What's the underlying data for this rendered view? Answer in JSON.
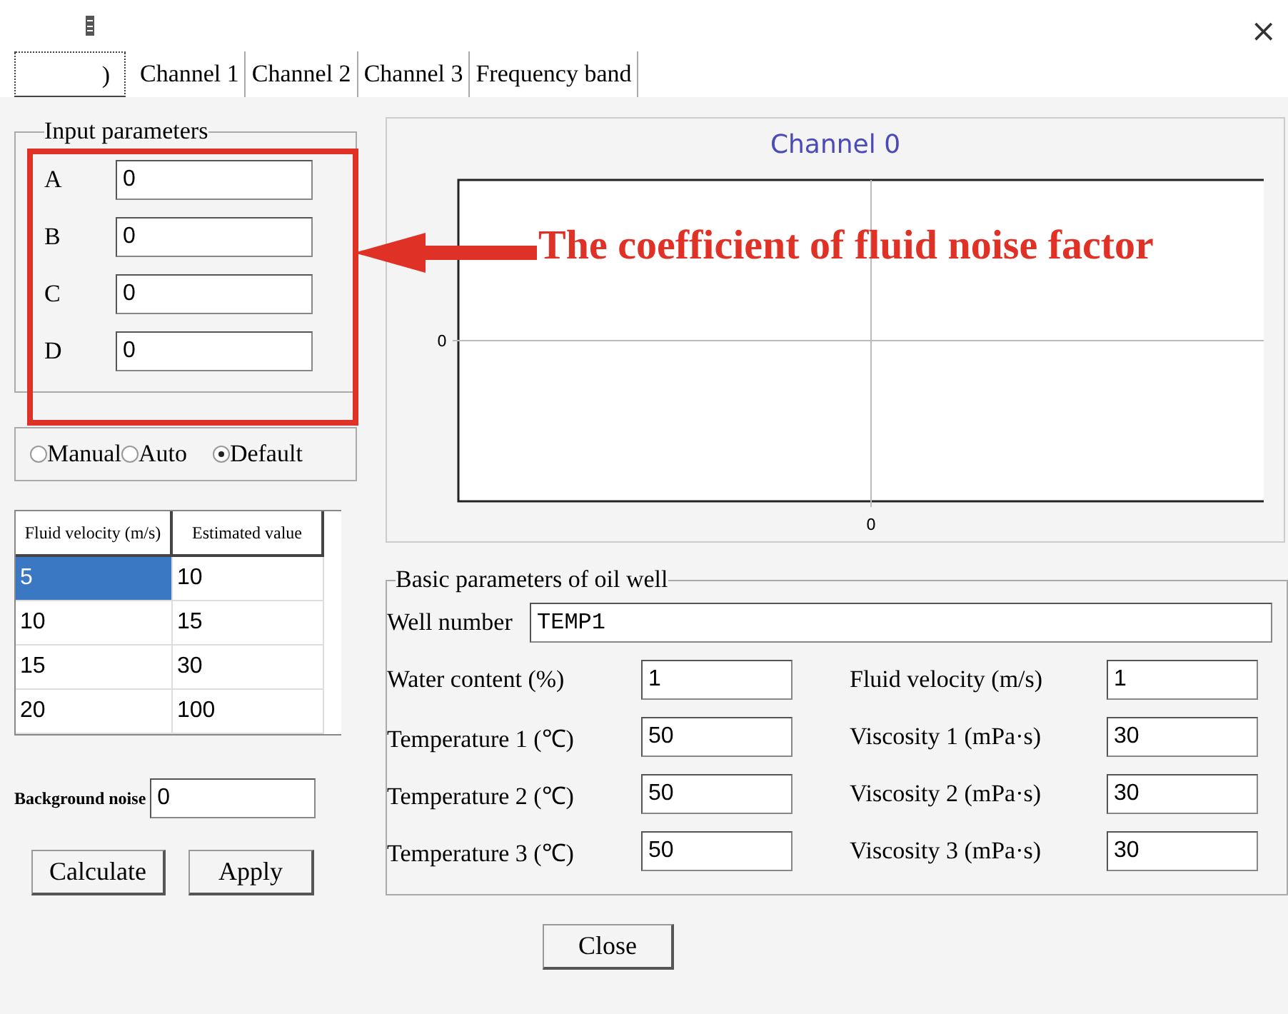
{
  "window": {
    "close": "×"
  },
  "tabs": [
    {
      "label": ")",
      "selected": true
    },
    {
      "label": "Channel 1",
      "selected": false
    },
    {
      "label": "Channel 2",
      "selected": false
    },
    {
      "label": "Channel 3",
      "selected": false
    },
    {
      "label": "Frequency band",
      "selected": false
    }
  ],
  "input_parameters": {
    "title": "Input parameters",
    "fields": [
      {
        "label": "A",
        "value": "0"
      },
      {
        "label": "B",
        "value": "0"
      },
      {
        "label": "C",
        "value": "0"
      },
      {
        "label": "D",
        "value": "0"
      }
    ]
  },
  "annotation": {
    "text": "The coefficient of fluid noise factor"
  },
  "mode": [
    {
      "label": "Manual",
      "selected": false
    },
    {
      "label": "Auto",
      "selected": false
    },
    {
      "label": "Default",
      "selected": true
    }
  ],
  "table": {
    "columns": [
      "Fluid velocity (m/s)",
      "Estimated value"
    ],
    "rows": [
      {
        "cells": [
          "5",
          "10"
        ],
        "selected": true
      },
      {
        "cells": [
          "10",
          "15"
        ],
        "selected": false
      },
      {
        "cells": [
          "15",
          "30"
        ],
        "selected": false
      },
      {
        "cells": [
          "20",
          "100"
        ],
        "selected": false
      }
    ]
  },
  "background_noise": {
    "label": "Background noise",
    "value": "0"
  },
  "buttons": [
    "Calculate",
    "Apply"
  ],
  "chart": {
    "title": "Channel 0",
    "y_tick": "0",
    "x_tick": "0"
  },
  "well": {
    "title": "Basic parameters of oil well",
    "well_number": {
      "label": "Well number",
      "value": "TEMP1"
    },
    "fields": [
      {
        "label": "Water content (%)",
        "value": "1"
      },
      {
        "label": "Fluid velocity (m/s)",
        "value": "1"
      },
      {
        "label": "Temperature 1 (℃)",
        "value": "50"
      },
      {
        "label": "Viscosity 1 (mPa·s)",
        "value": "30"
      },
      {
        "label": "Temperature 2 (℃)",
        "value": "50"
      },
      {
        "label": "Viscosity 2 (mPa·s)",
        "value": "30"
      },
      {
        "label": "Temperature 3 (℃)",
        "value": "50"
      },
      {
        "label": "Viscosity 3 (mPa·s)",
        "value": "30"
      }
    ]
  },
  "close_button": "Close"
}
